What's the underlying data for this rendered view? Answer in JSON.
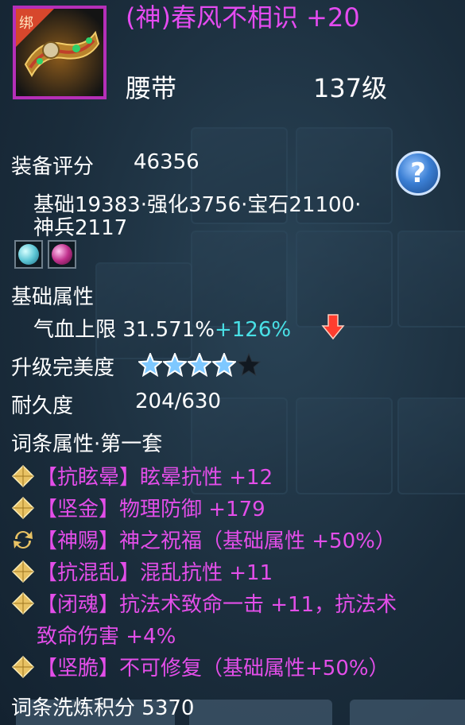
{
  "header": {
    "bound_label": "绑",
    "title": "(神)春风不相识 +20",
    "type": "腰带",
    "level": "137级"
  },
  "help": {
    "label": "?"
  },
  "score": {
    "label": "装备评分",
    "value": "46356",
    "breakdown_line1": "基础19383·强化3756·宝石21100·",
    "breakdown_line2": "神兵2117"
  },
  "gems": [
    {
      "name": "cyan-gem",
      "color": "#5ec7d6"
    },
    {
      "name": "magenta-gem",
      "color": "#c0308c"
    }
  ],
  "base_attr": {
    "label": "基础属性",
    "stat": "气血上限 31.571%",
    "bonus": "+126%"
  },
  "perfection": {
    "label": "升级完美度",
    "stars_filled": 4,
    "stars_total": 5
  },
  "durability": {
    "label": "耐久度",
    "value": "204/630"
  },
  "affixes": {
    "label": "词条属性·第一套",
    "items": [
      {
        "text": "【抗眩晕】眩晕抗性 +12",
        "icon": "diamond-icon"
      },
      {
        "text": "【坚金】物理防御 +179",
        "icon": "diamond-icon"
      },
      {
        "text": "【神赐】神之祝福（基础属性 +50%）",
        "icon": "refresh-icon"
      },
      {
        "text": "【抗混乱】混乱抗性 +11",
        "icon": "diamond-icon"
      },
      {
        "text": "【闭魂】抗法术致命一击 +11，抗法术",
        "text2": "致命伤害 +4%",
        "icon": "diamond-icon"
      },
      {
        "text": "【坚脆】不可修复（基础属性+50%）",
        "icon": "diamond-icon"
      }
    ]
  },
  "refine": {
    "label": "词条洗炼积分",
    "value": "5370"
  },
  "colors": {
    "title": "#e44bf0",
    "frame": "#b52fb8",
    "bonus": "#49e0e6",
    "star": "#7ec8ff"
  }
}
